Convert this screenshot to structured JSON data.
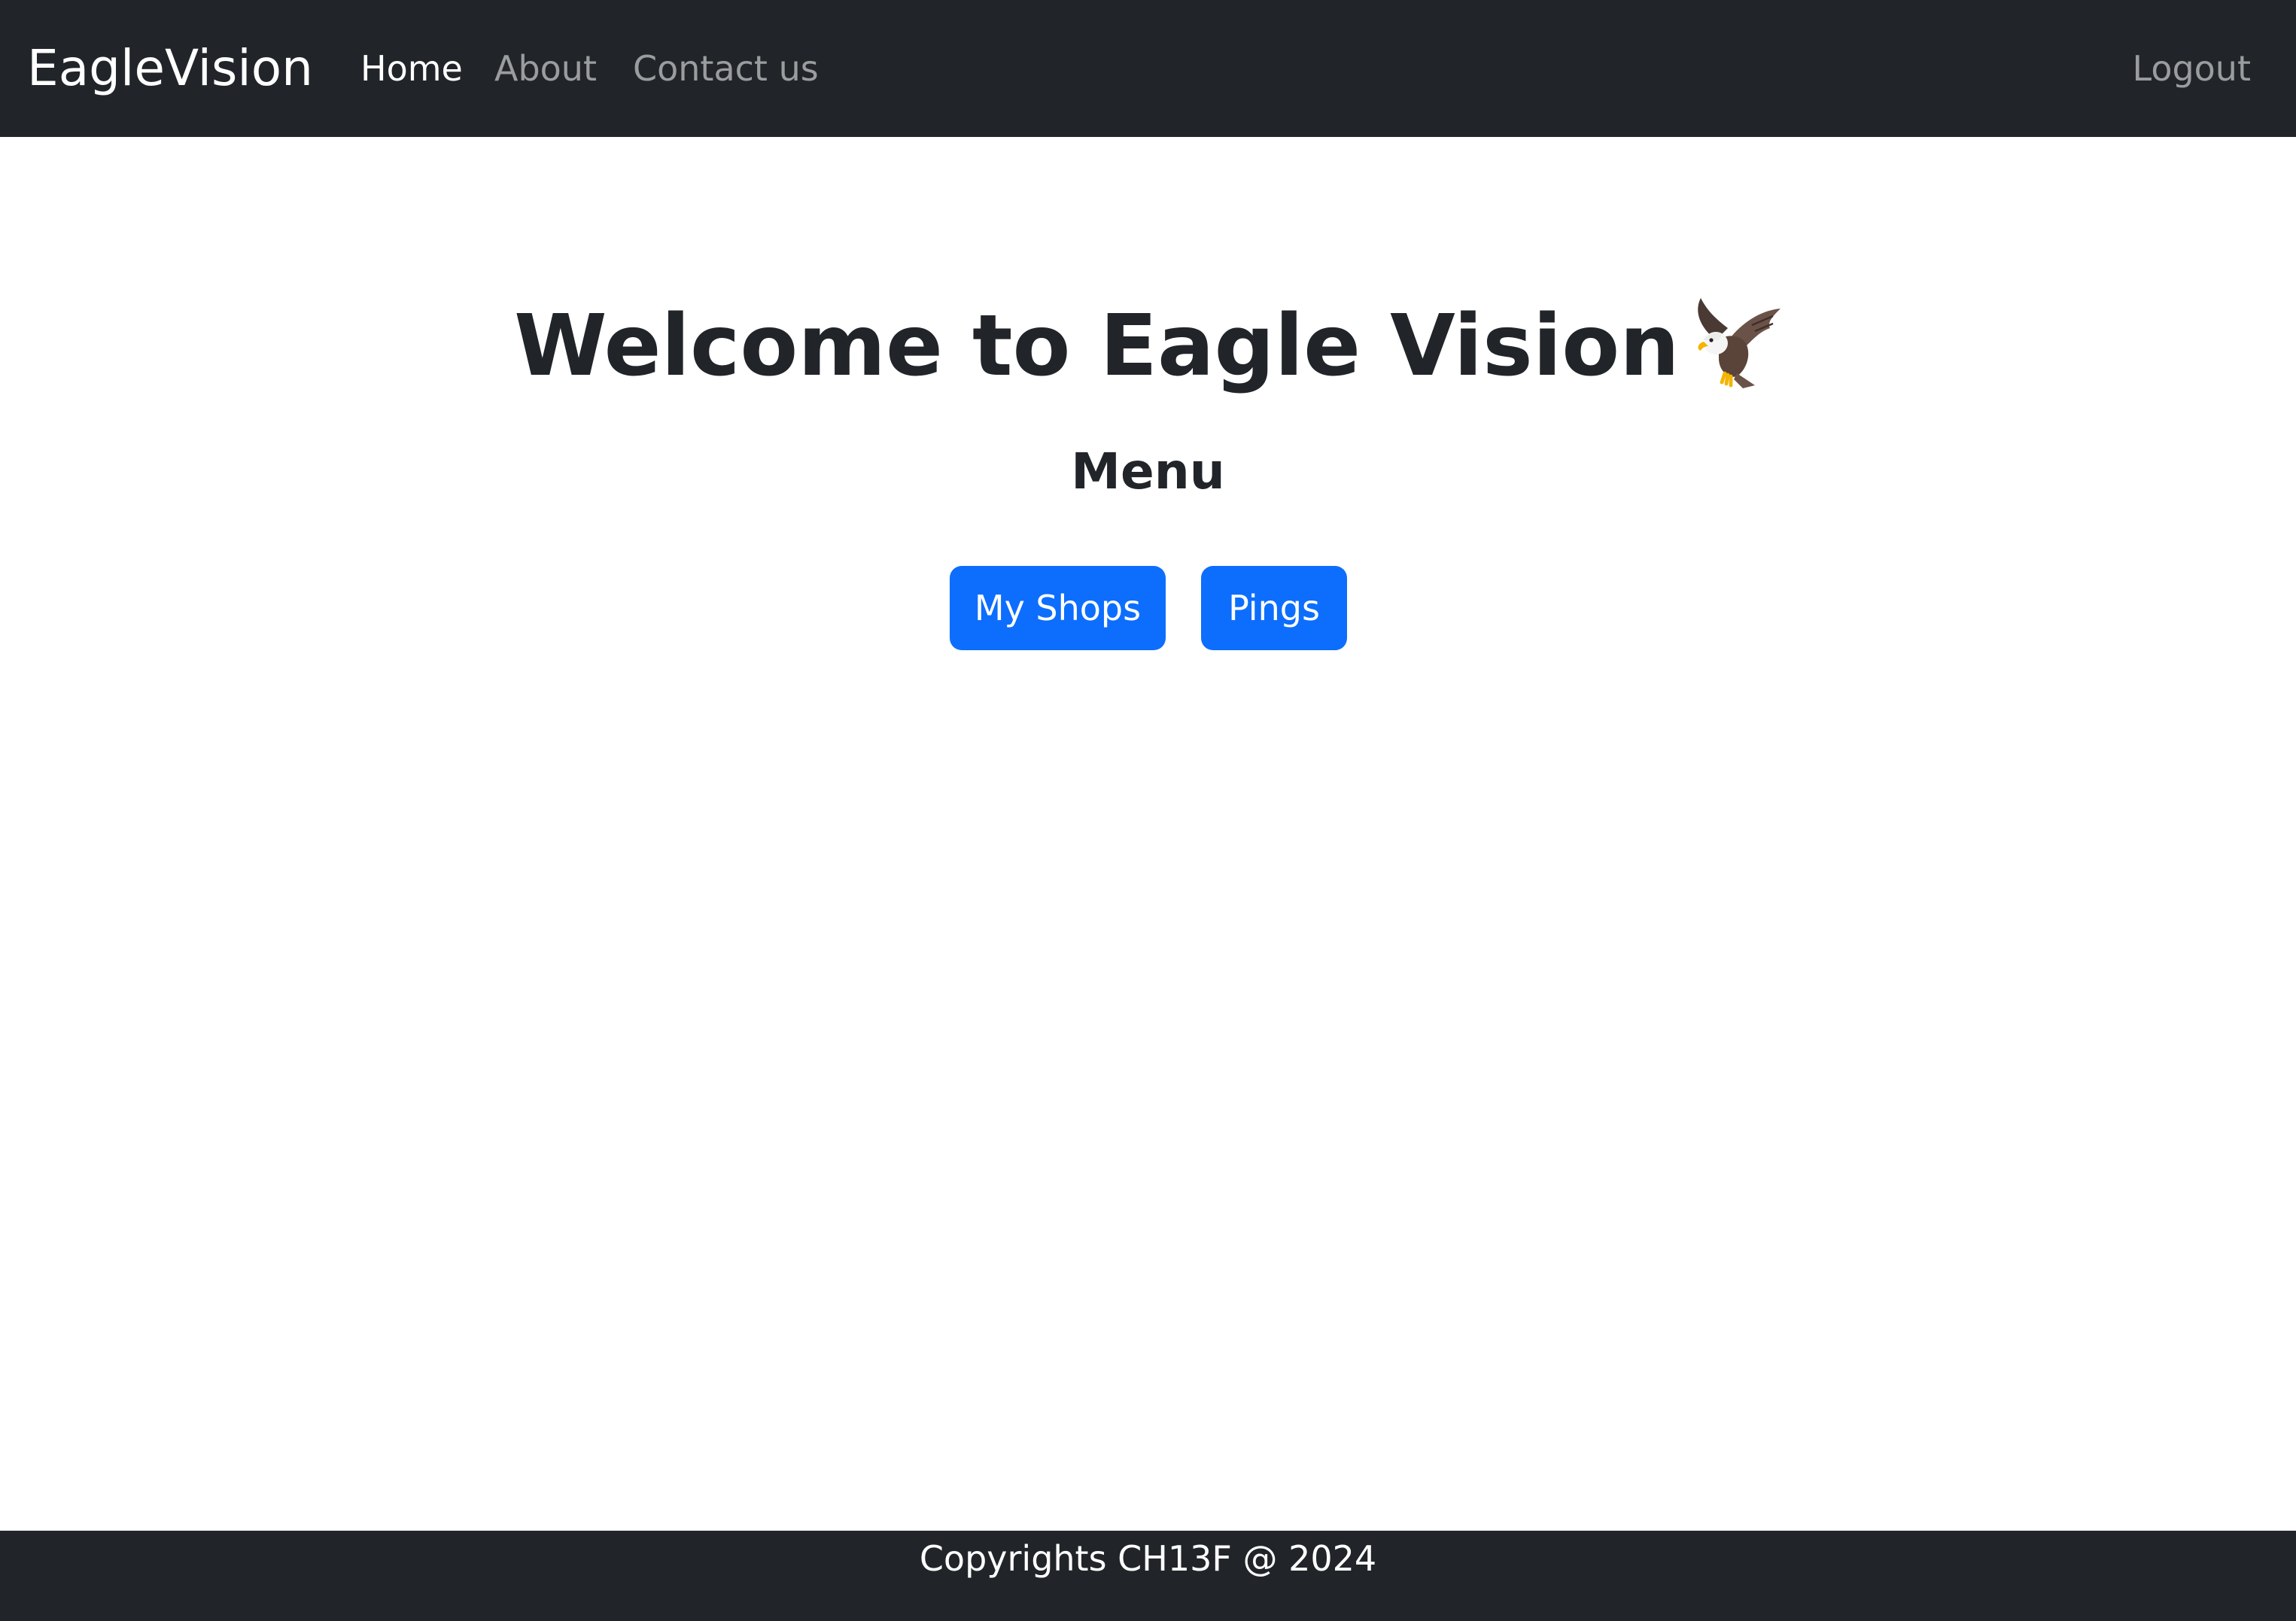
{
  "navbar": {
    "brand": "EagleVision",
    "links": [
      {
        "label": "Home",
        "active": true
      },
      {
        "label": "About",
        "active": false
      },
      {
        "label": "Contact us",
        "active": false
      }
    ],
    "logout_label": "Logout"
  },
  "main": {
    "title": "Welcome to Eagle Vision",
    "title_icon": "eagle-icon",
    "menu_heading": "Menu",
    "buttons": [
      {
        "label": "My Shops"
      },
      {
        "label": "Pings"
      }
    ]
  },
  "footer": {
    "text": "Copyrights CH13F @ 2024"
  },
  "colors": {
    "navbar_bg": "#212529",
    "primary": "#0d6efd",
    "text": "#212529",
    "nav_inactive": "rgba(255,255,255,0.55)"
  }
}
